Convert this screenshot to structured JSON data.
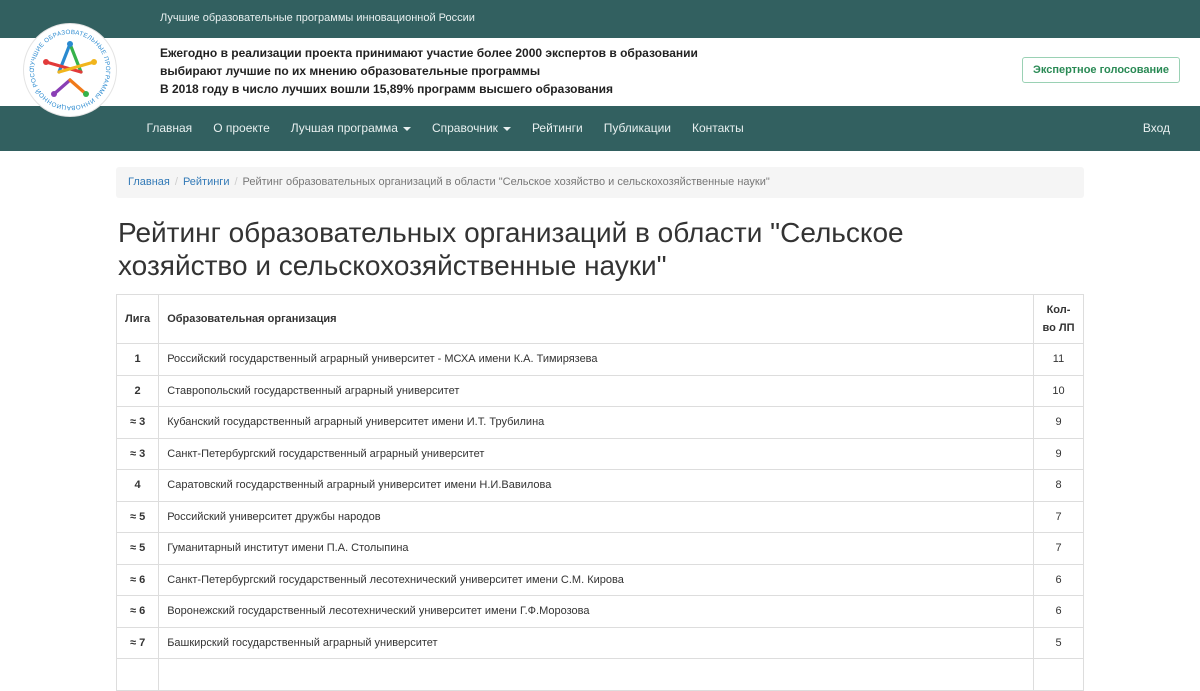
{
  "topbar": {
    "tagline": "Лучшие образовательные программы инновационной России"
  },
  "header": {
    "lines": [
      "Ежегодно в реализации проекта принимают участие более 2000 экспертов в образовании",
      "выбирают лучшие по их мнению образовательные программы",
      "В 2018 году в число лучших вошли 15,89% программ высшего образования"
    ],
    "vote_button": "Экспертное голосование",
    "logo_text": "ЛУЧШИЕ ОБРАЗОВАТЕЛЬНЫЕ ПРОГРАММЫ ИННОВАЦИОННОЙ РОССИИ"
  },
  "nav": {
    "items": [
      "Главная",
      "О проекте",
      "Лучшая программа",
      "Справочник",
      "Рейтинги",
      "Публикации",
      "Контакты"
    ],
    "login": "Вход"
  },
  "breadcrumb": {
    "home": "Главная",
    "ratings": "Рейтинги",
    "current": "Рейтинг образовательных организаций в области \"Сельское хозяйство и сельскохозяйственные науки\""
  },
  "page": {
    "title": "Рейтинг образовательных организаций в области \"Сельское хозяйство и сельскохозяйственные науки\""
  },
  "table": {
    "headers": {
      "league": "Лига",
      "org": "Образовательная организация",
      "count": "Кол-во ЛП"
    },
    "rows": [
      {
        "league": "1",
        "org": "Российский государственный аграрный университет - МСХА имени К.А. Тимирязева",
        "count": "11"
      },
      {
        "league": "2",
        "org": "Ставропольский государственный аграрный университет",
        "count": "10"
      },
      {
        "league": "≈ 3",
        "org": "Кубанский государственный аграрный университет имени И.Т. Трубилина",
        "count": "9"
      },
      {
        "league": "≈ 3",
        "org": "Санкт-Петербургский государственный аграрный университет",
        "count": "9"
      },
      {
        "league": "4",
        "org": "Саратовский государственный аграрный университет имени Н.И.Вавилова",
        "count": "8"
      },
      {
        "league": "≈ 5",
        "org": "Российский университет дружбы народов",
        "count": "7"
      },
      {
        "league": "≈ 5",
        "org": "Гуманитарный институт имени П.А. Столыпина",
        "count": "7"
      },
      {
        "league": "≈ 6",
        "org": "Санкт-Петербургский государственный лесотехнический университет имени С.М. Кирова",
        "count": "6"
      },
      {
        "league": "≈ 6",
        "org": "Воронежский государственный лесотехнический университет имени Г.Ф.Морозова",
        "count": "6"
      },
      {
        "league": "≈ 7",
        "org": "Башкирский государственный аграрный университет",
        "count": "5"
      },
      {
        "league": "",
        "org": "",
        "count": ""
      }
    ]
  },
  "colors": {
    "brand": "#326060",
    "accent_button": "#2a8a55",
    "link": "#337ab7"
  }
}
